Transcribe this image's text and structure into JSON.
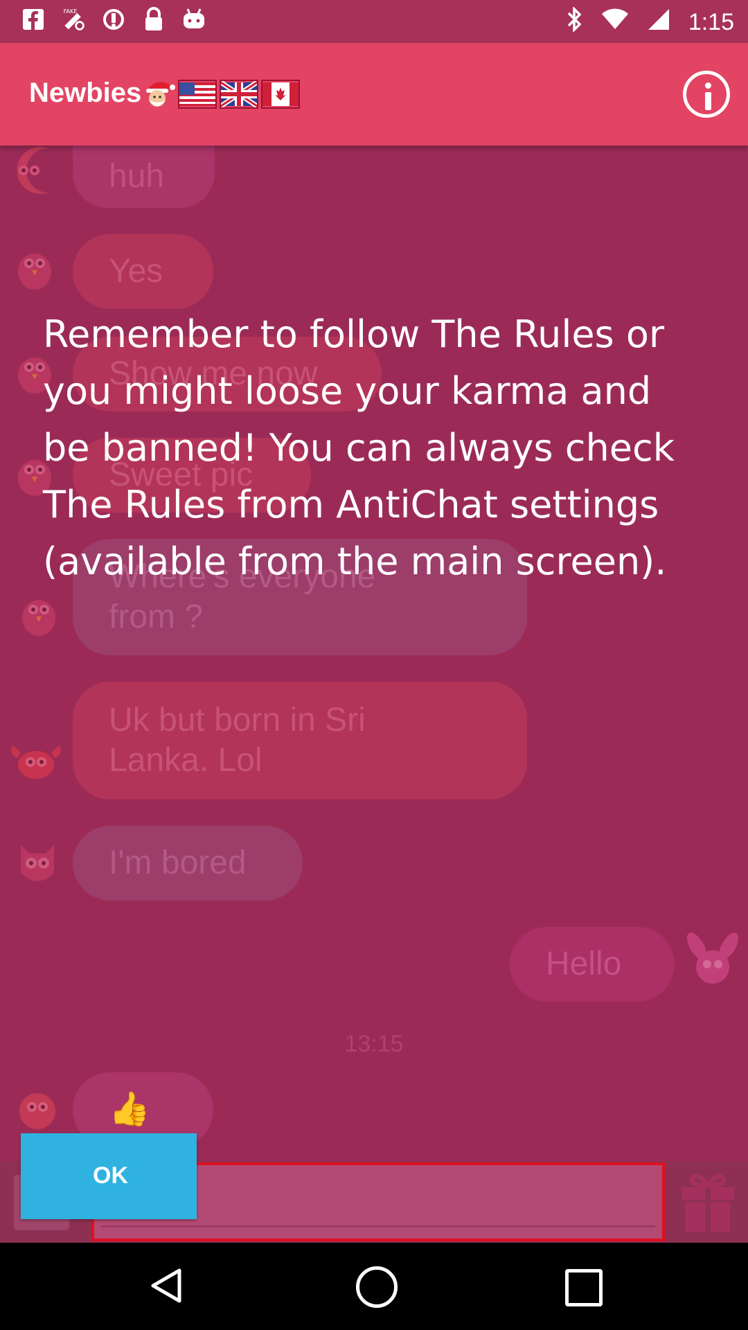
{
  "status_bar": {
    "time": "1:15",
    "left_icons": [
      "facebook-icon",
      "fake-gps-icon",
      "sync-icon",
      "lock-icon",
      "android-icon"
    ],
    "right_icons": [
      "bluetooth-icon",
      "wifi-icon",
      "signal-icon"
    ]
  },
  "app_bar": {
    "title": "Newbies",
    "title_icons": [
      "santa-emoji-icon",
      "us-flag-icon",
      "uk-flag-icon",
      "canada-flag-icon"
    ],
    "info_icon": "info-icon"
  },
  "messages": [
    {
      "text": "huh",
      "side": "left",
      "avatar": "moon-fish-avatar"
    },
    {
      "text": "Yes",
      "side": "left",
      "avatar": "bird-avatar"
    },
    {
      "text": "Show me now",
      "side": "left",
      "avatar": "bird-avatar"
    },
    {
      "text": "Sweet pic",
      "side": "left",
      "avatar": "bird-avatar"
    },
    {
      "text": "Where's everyone from ?",
      "side": "left",
      "avatar": "bird-avatar"
    },
    {
      "text": "Uk but born in Sri Lanka. Lol",
      "side": "left",
      "avatar": "crab-avatar"
    },
    {
      "text": "I'm bored",
      "side": "left",
      "avatar": "owl-avatar"
    },
    {
      "text": "Hello",
      "side": "right",
      "avatar": "bunny-avatar"
    },
    {
      "text": "👍",
      "side": "left",
      "avatar": "turkey-avatar"
    }
  ],
  "timestamp": "13:15",
  "dialog": {
    "message": "Remember to follow The Rules or you might loose your karma and be banned! You can always check The Rules from AntiChat settings (available from the main screen).",
    "ok_label": "OK"
  },
  "input_bar": {
    "placeholder": "",
    "gift_icon": "gift-icon"
  },
  "nav_bar": {
    "icons": [
      "back-icon",
      "home-icon",
      "recent-apps-icon"
    ]
  }
}
